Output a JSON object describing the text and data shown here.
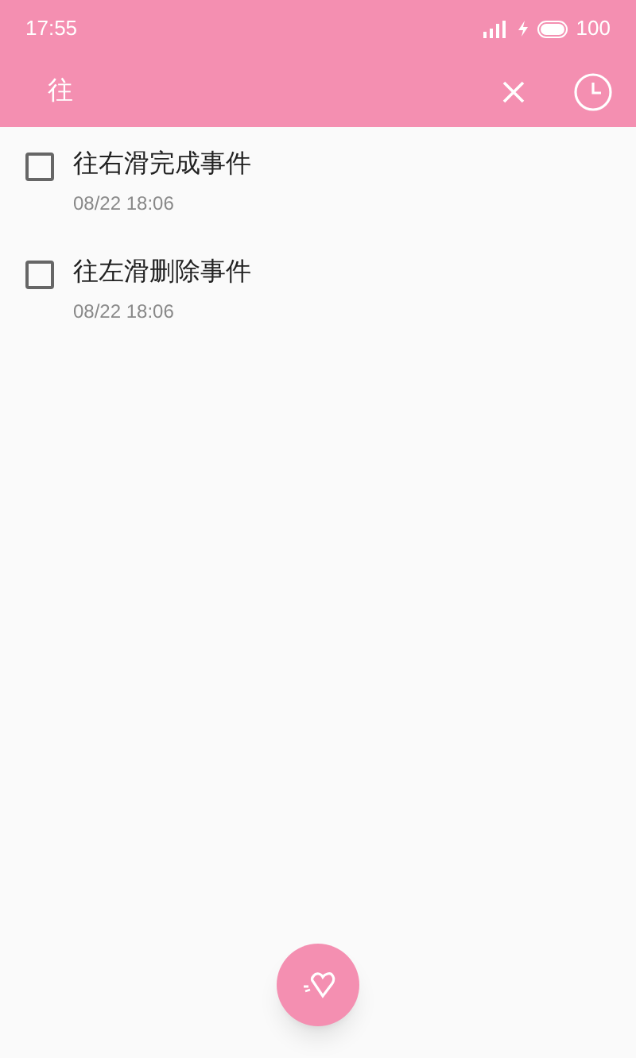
{
  "status_bar": {
    "time": "17:55",
    "battery": "100"
  },
  "search": {
    "value": "往"
  },
  "items": [
    {
      "title": "往右滑完成事件",
      "date": "08/22 18:06",
      "checked": false
    },
    {
      "title": "往左滑删除事件",
      "date": "08/22 18:06",
      "checked": false
    }
  ]
}
